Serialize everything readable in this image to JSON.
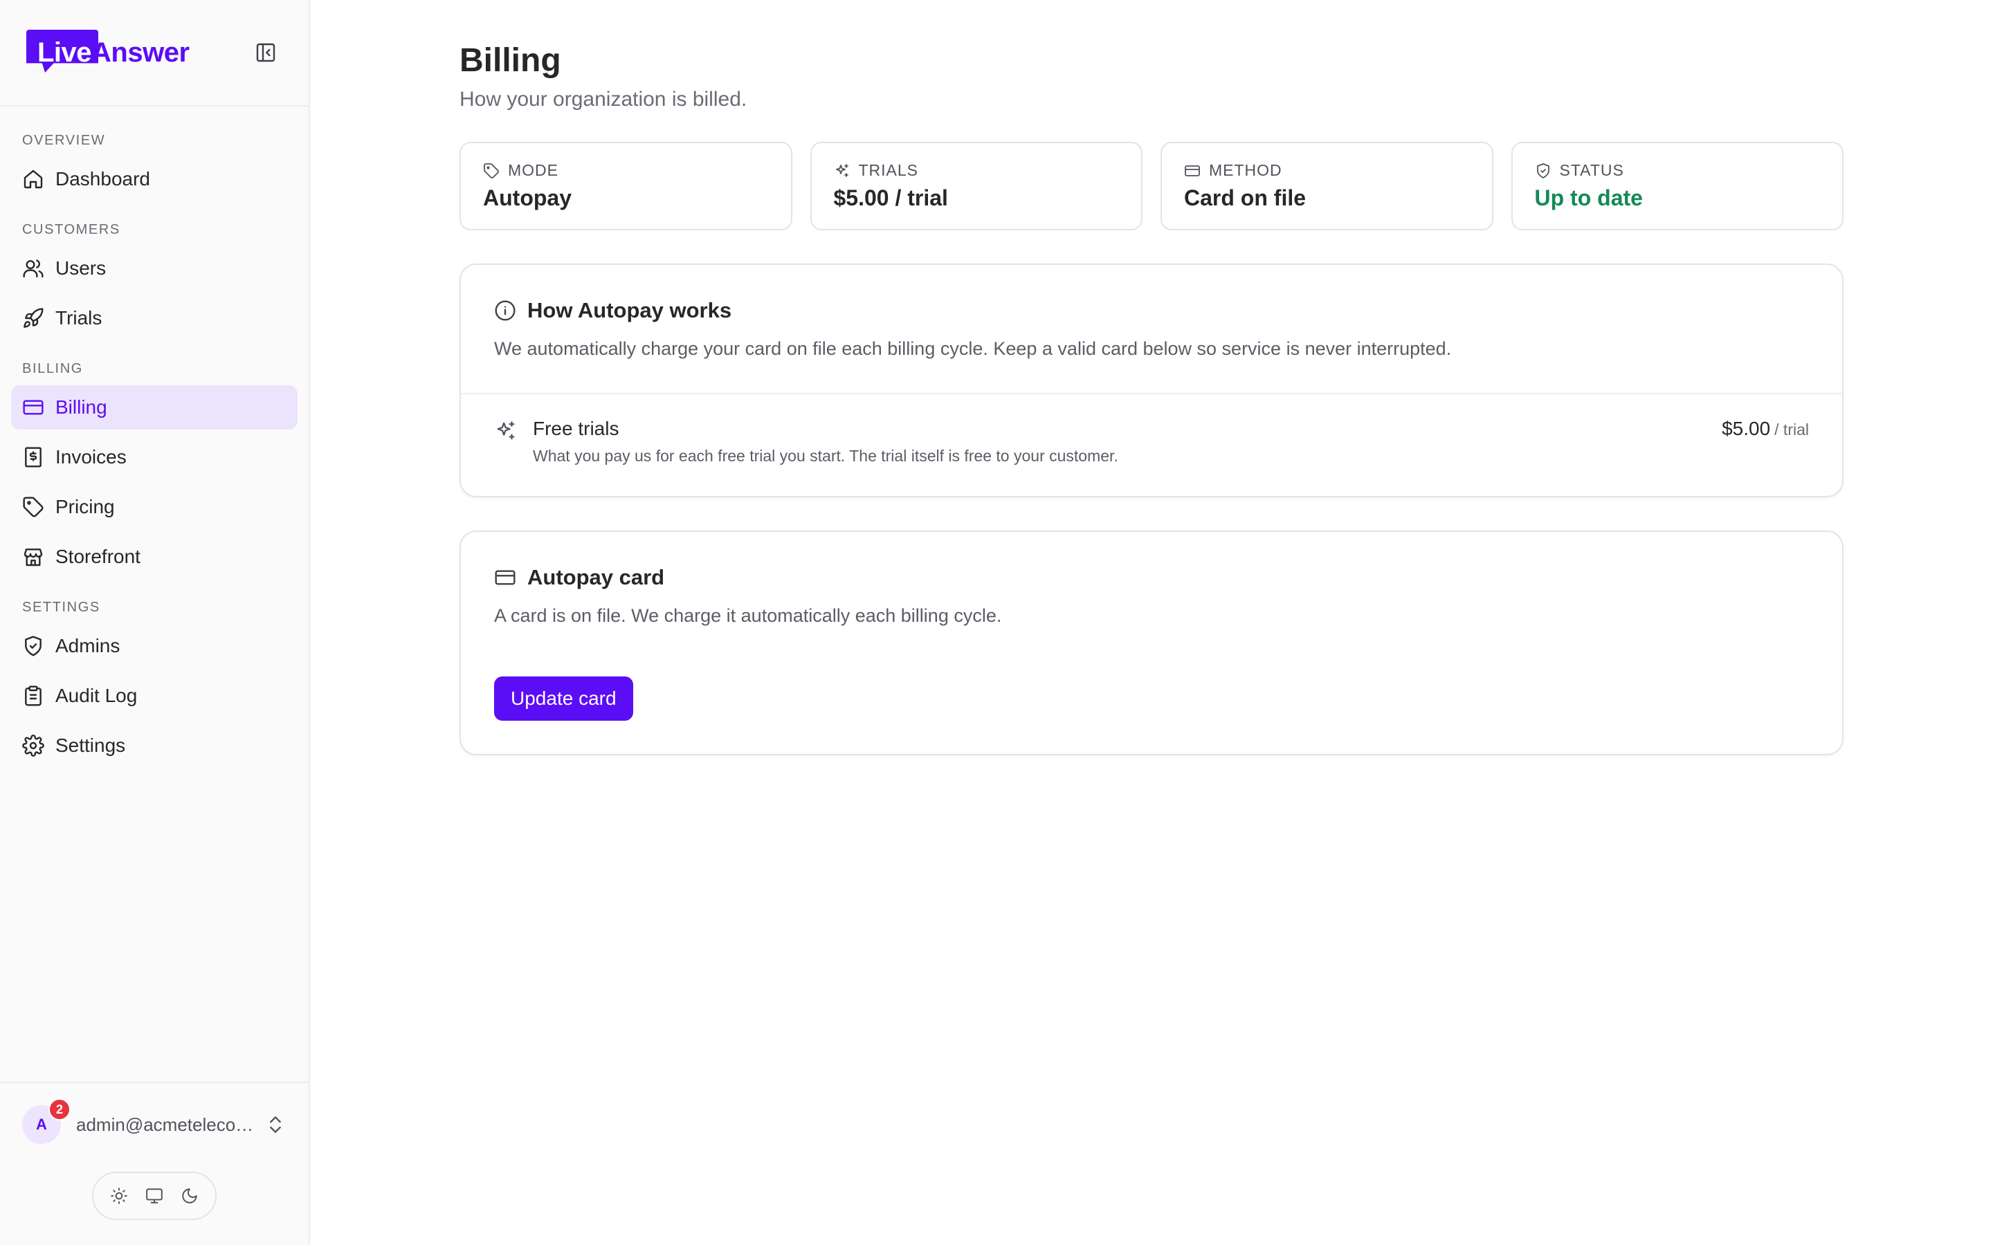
{
  "brand": {
    "part1": "Live",
    "part2": "Answer",
    "accent": "#5b0df5"
  },
  "sidebar": {
    "sections": [
      {
        "label": "OVERVIEW",
        "items": [
          {
            "label": "Dashboard",
            "icon": "home-icon"
          }
        ]
      },
      {
        "label": "CUSTOMERS",
        "items": [
          {
            "label": "Users",
            "icon": "users-icon"
          },
          {
            "label": "Trials",
            "icon": "rocket-icon"
          }
        ]
      },
      {
        "label": "BILLING",
        "items": [
          {
            "label": "Billing",
            "icon": "credit-card-icon",
            "active": true
          },
          {
            "label": "Invoices",
            "icon": "receipt-dollar-icon"
          },
          {
            "label": "Pricing",
            "icon": "tag-icon"
          },
          {
            "label": "Storefront",
            "icon": "store-icon"
          }
        ]
      },
      {
        "label": "SETTINGS",
        "items": [
          {
            "label": "Admins",
            "icon": "shield-icon"
          },
          {
            "label": "Audit Log",
            "icon": "clipboard-icon"
          },
          {
            "label": "Settings",
            "icon": "gear-icon"
          }
        ]
      }
    ],
    "account": {
      "initial": "A",
      "notifications": "2",
      "email": "admin@acmetelecom.com"
    },
    "theme_options": [
      "light",
      "system",
      "dark"
    ]
  },
  "page": {
    "title": "Billing",
    "subtitle": "How your organization is billed."
  },
  "stats": [
    {
      "label": "MODE",
      "value": "Autopay",
      "icon": "tag-icon"
    },
    {
      "label": "TRIALS",
      "value": "$5.00 / trial",
      "icon": "sparkles-icon"
    },
    {
      "label": "METHOD",
      "value": "Card on file",
      "icon": "credit-card-icon"
    },
    {
      "label": "STATUS",
      "value": "Up to date",
      "icon": "shield-check-icon",
      "color": "#138a55"
    }
  ],
  "autopay_info": {
    "title": "How Autopay works",
    "description": "We automatically charge your card on file each billing cycle. Keep a valid card below so service is never interrupted.",
    "row": {
      "title": "Free trials",
      "subtitle": "What you pay us for each free trial you start. The trial itself is free to your customer.",
      "price": "$5.00",
      "unit": "/ trial"
    }
  },
  "autopay_card": {
    "title": "Autopay card",
    "description": "A card is on file. We charge it automatically each billing cycle.",
    "button_label": "Update card"
  }
}
